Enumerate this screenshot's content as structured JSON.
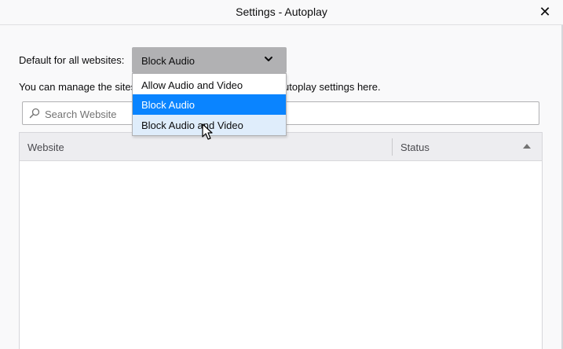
{
  "window": {
    "title": "Settings - Autoplay",
    "close_symbol": "✕"
  },
  "default_setting": {
    "label": "Default for all websites:",
    "selected": "Block Audio",
    "options": [
      "Allow Audio and Video",
      "Block Audio",
      "Block Audio and Video"
    ],
    "highlighted_option": "Block Audio and Video"
  },
  "description": {
    "visible_left": "You can manage the sites",
    "visible_right": "utoplay settings here."
  },
  "search": {
    "placeholder": "Search Website",
    "value": "",
    "icon": "search-icon"
  },
  "table": {
    "columns": [
      "Website",
      "Status"
    ],
    "sort_column": "Status",
    "sort_direction": "ascending",
    "rows": []
  },
  "colors": {
    "selected_option": "#0a84ff",
    "hovered_option": "#dfedfb",
    "select_background": "#b1b1b3"
  }
}
